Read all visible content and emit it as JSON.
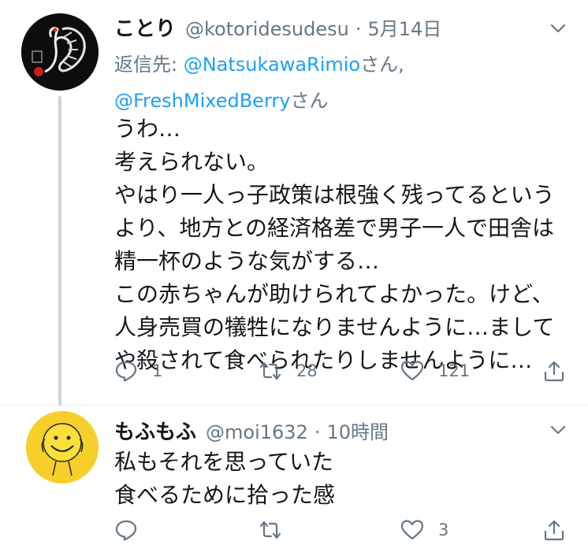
{
  "tweet1": {
    "display_name": "ことり",
    "handle": "@kotoridesudesu",
    "separator": "·",
    "time": "5月14日",
    "reply_prefix": "返信先: ",
    "mention1": "@NatsukawaRimio",
    "mention1_suffix": "さん,",
    "mention2": "@FreshMixedBerry",
    "mention2_suffix": "さん",
    "body_lines": [
      "うわ…",
      "考えられない。",
      "やはり一人っ子政策は根強く残ってるという",
      "より、地方との経済格差で男子一人で田舎は",
      "精一杯のような気がする…",
      "この赤ちゃんが助けられてよかった。けど、",
      "人身売買の犠牲になりませんように…まして",
      "や殺されて食べられたりしませんように…"
    ],
    "reply_count": "1",
    "retweet_count": "28",
    "like_count": "121"
  },
  "tweet2": {
    "display_name": "もふもふ",
    "handle": "@moi1632",
    "separator": "·",
    "time": "10時間",
    "body_lines": [
      "私もそれを思っていた",
      "食べるために拾った感"
    ],
    "reply_count": "",
    "retweet_count": "",
    "like_count": "3"
  },
  "icons": {
    "reply": "reply-icon",
    "retweet": "retweet-icon",
    "like": "heart-icon",
    "share": "share-icon",
    "more": "chevron-down-icon"
  },
  "colors": {
    "text": "#14171a",
    "secondary": "#657786",
    "link": "#1da1f2",
    "thread_line": "#ccd6dd"
  }
}
